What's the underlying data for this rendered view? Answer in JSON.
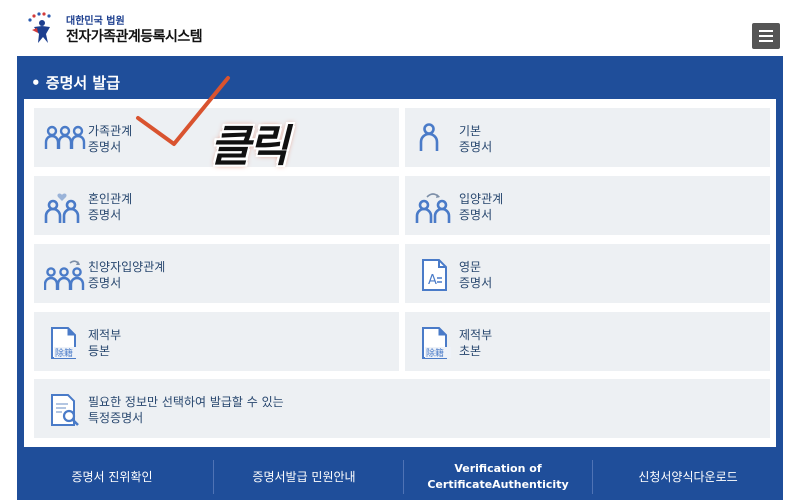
{
  "header": {
    "court_name": "대한민국 법원",
    "site_name": "전자가족관계등록시스템",
    "menu_icon": "hamburger-menu-icon"
  },
  "panel": {
    "title": "• 증명서 발급",
    "cards": [
      {
        "line1": "가족관계",
        "line2": "증명서",
        "icon": "family-icon"
      },
      {
        "line1": "기본",
        "line2": "증명서",
        "icon": "person-icon"
      },
      {
        "line1": "혼인관계",
        "line2": "증명서",
        "icon": "marriage-icon"
      },
      {
        "line1": "입양관계",
        "line2": "증명서",
        "icon": "adoption-icon"
      },
      {
        "line1": "친양자입양관계",
        "line2": "증명서",
        "icon": "full-adoption-icon"
      },
      {
        "line1": "영문",
        "line2": "증명서",
        "icon": "english-document-icon"
      },
      {
        "line1": "제적부",
        "line2": "등본",
        "icon": "removed-register-icon",
        "badge": "除籍"
      },
      {
        "line1": "제적부",
        "line2": "초본",
        "icon": "removed-register-icon",
        "badge": "除籍"
      },
      {
        "line1": "필요한 정보만 선택하여 발급할 수 있는",
        "line2": "특정증명서",
        "icon": "document-search-icon"
      }
    ]
  },
  "annotation": {
    "click_text": "클릭",
    "check_icon": "checkmark-icon",
    "check_color": "#d9532f"
  },
  "footer": {
    "items": [
      {
        "line1": "증명서 진위확인",
        "line2": ""
      },
      {
        "line1": "증명서발급 민원안내",
        "line2": ""
      },
      {
        "line1": "Verification of",
        "line2": "CertificateAuthenticity"
      },
      {
        "line1": "신청서양식다운로드",
        "line2": ""
      }
    ]
  },
  "colors": {
    "brand_blue": "#1f4e9a",
    "card_bg": "#edf0f3",
    "icon_blue": "#4a7bc8"
  }
}
